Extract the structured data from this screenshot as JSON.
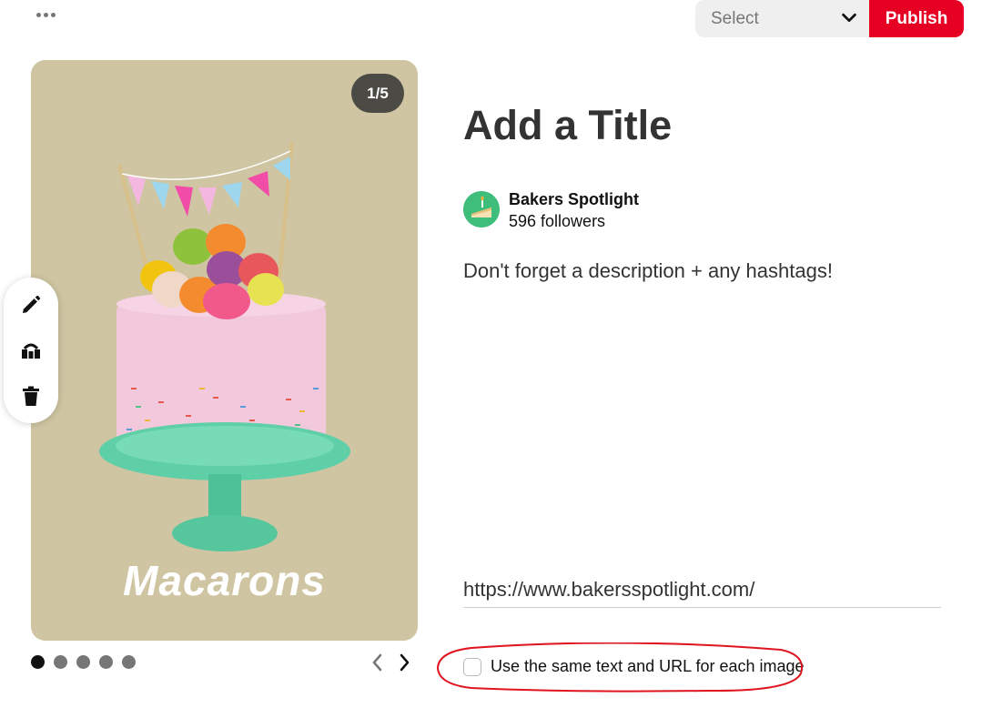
{
  "header": {
    "more_icon": "ellipsis-icon",
    "board_select_placeholder": "Select",
    "publish_label": "Publish",
    "accent_color": "#e60023"
  },
  "image_panel": {
    "counter": "1/5",
    "caption": "Macarons",
    "background_color": "#cfc5a2",
    "tools": [
      "edit-icon",
      "reorder-icon",
      "trash-icon"
    ],
    "pager": {
      "total": 5,
      "active_index": 0
    },
    "nav": [
      "chevron-left-icon",
      "chevron-right-icon"
    ]
  },
  "details": {
    "title_placeholder": "Add a Title",
    "account": {
      "name": "Bakers Spotlight",
      "followers": "596 followers"
    },
    "description_placeholder": "Don't forget a description + any hashtags!",
    "url": "https://www.bakersspotlight.com/",
    "same_text_label": "Use the same text and URL for each image",
    "same_text_checked": false
  }
}
